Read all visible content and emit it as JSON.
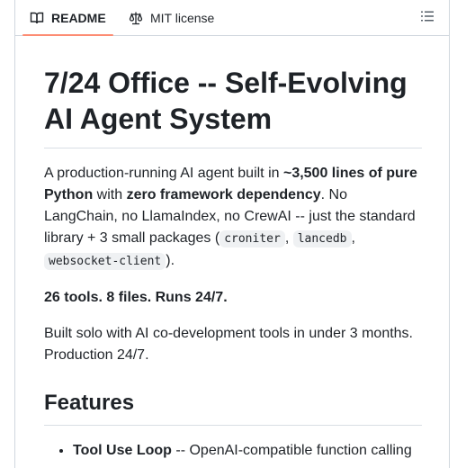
{
  "tabs": {
    "readme": {
      "label": "README",
      "icon": "book-icon"
    },
    "license": {
      "label": "MIT license",
      "icon": "law-scale-icon"
    },
    "outline_icon": "list-unordered-icon",
    "active_color": "#fd8c73"
  },
  "readme": {
    "title": "7/24 Office -- Self-Evolving AI Agent System",
    "intro": {
      "t1": "A production-running AI agent built in ",
      "b1": "~3,500 lines of pure Python",
      "t2": " with ",
      "b2": "zero framework dependency",
      "t3": ". No LangChain, no LlamaIndex, no CrewAI -- just the standard library + 3 small packages (",
      "c1": "croniter",
      "sep1": ", ",
      "c2": "lancedb",
      "sep2": ", ",
      "c3": "websocket-client",
      "t4": ")."
    },
    "summary": "26 tools. 8 files. Runs 24/7.",
    "built": "Built solo with AI co-development tools in under 3 months. Production 24/7.",
    "features_heading": "Features",
    "features": [
      {
        "name": "Tool Use Loop",
        "desc": " -- OpenAI-compatible function calling"
      }
    ]
  }
}
